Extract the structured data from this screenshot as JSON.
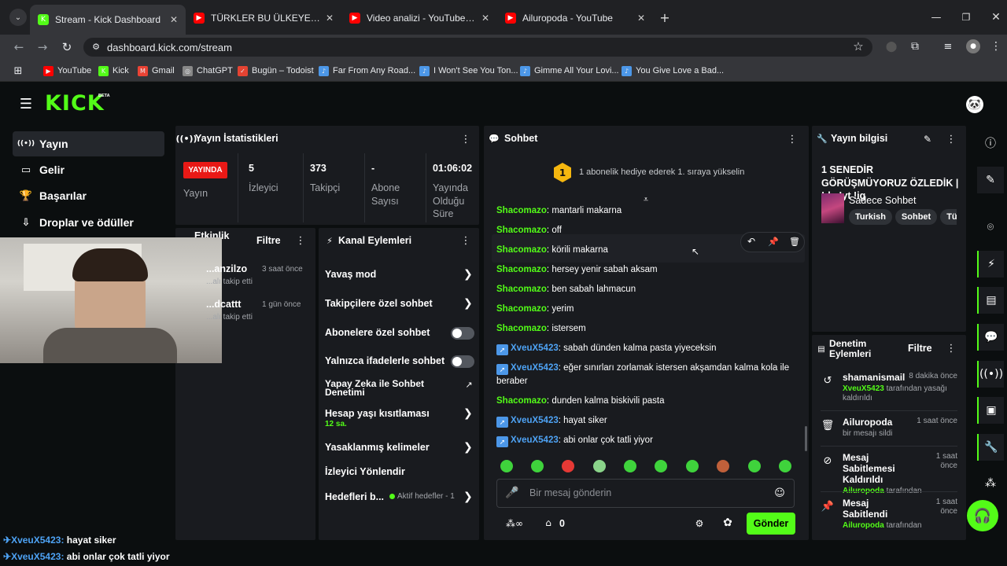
{
  "browser": {
    "tabs": [
      {
        "title": "Stream - Kick Dashboard",
        "active": true,
        "fav": "K",
        "favbg": "#53fc18"
      },
      {
        "title": "TÜRKLER BU ÜLKEYE MUTLAKA",
        "active": false,
        "fav": "▶",
        "favbg": "#ff0000"
      },
      {
        "title": "Video analizi - YouTube Studio",
        "active": false,
        "fav": "▶",
        "favbg": "#ff0000"
      },
      {
        "title": "Ailuropoda - YouTube",
        "active": false,
        "fav": "▶",
        "favbg": "#ff0000"
      }
    ],
    "url": "dashboard.kick.com/stream",
    "bookmarks": [
      "YouTube",
      "Kick",
      "Gmail",
      "ChatGPT",
      "Bugün – Todoist",
      "Far From Any Road...",
      "I Won't See You Ton...",
      "Gimme All Your Lovi...",
      "You Give Love a Bad..."
    ]
  },
  "brand": {
    "logo": "KICK",
    "beta": "BETA"
  },
  "sidebar": {
    "items": [
      {
        "label": "Yayın",
        "icon": "broadcast-icon"
      },
      {
        "label": "Gelir",
        "icon": "money-icon"
      },
      {
        "label": "Başarılar",
        "icon": "trophy-icon"
      },
      {
        "label": "Droplar ve ödüller",
        "icon": "gift-icon"
      }
    ]
  },
  "stats": {
    "title": "Yayın İstatistikleri",
    "live_badge": "YAYINDA",
    "live_label": "Yayın",
    "items": [
      {
        "value": "5",
        "label": "İzleyici"
      },
      {
        "value": "373",
        "label": "Takipçi"
      },
      {
        "value": "-",
        "label": "Abone Sayısı"
      },
      {
        "value": "01:06:02",
        "label": "Yayında Olduğu Süre"
      }
    ]
  },
  "activity": {
    "title": "Etkinlik",
    "filter": "Filtre",
    "items": [
      {
        "name": "...anzilzo",
        "time": "3 saat önce",
        "desc": "...alı takip etti"
      },
      {
        "name": "...dcattt",
        "time": "1 gün önce",
        "desc": "...alı takip etti"
      }
    ]
  },
  "channel_actions": {
    "title": "Kanal Eylemleri",
    "rows": [
      {
        "label": "Yavaş mod"
      },
      {
        "label": "Takipçilere özel sohbet"
      },
      {
        "label": "Abonelere özel sohbet"
      },
      {
        "label": "Yalnızca ifadelerle sohbet"
      },
      {
        "label": "Yapay Zeka ile Sohbet Denetimi"
      },
      {
        "label": "Hesap yaşı kısıtlaması",
        "sub": "12 sa."
      },
      {
        "label": "Yasaklanmış kelimeler"
      },
      {
        "label": "İzleyici Yönlendir"
      },
      {
        "label": "Hedefleri b...",
        "status": "Aktif hedefler - 1"
      }
    ]
  },
  "chat": {
    "title": "Sohbet",
    "gift_rank": "1",
    "gift_text": "1 abonelik hediye ederek 1. sıraya yükselin",
    "messages": [
      {
        "user": "Shacomazo",
        "text": "mantarli makarna",
        "badge": false
      },
      {
        "user": "Shacomazo",
        "text": "off",
        "badge": false
      },
      {
        "user": "Shacomazo",
        "text": "körili makarna",
        "badge": false
      },
      {
        "user": "Shacomazo",
        "text": "hersey yenir sabah aksam",
        "badge": false
      },
      {
        "user": "Shacomazo",
        "text": "ben sabah lahmacun",
        "badge": false
      },
      {
        "user": "Shacomazo",
        "text": "yerim",
        "badge": false
      },
      {
        "user": "Shacomazo",
        "text": "istersem",
        "badge": false
      },
      {
        "user": "XveuX5423",
        "text": "sabah dünden kalma pasta yiyeceksin",
        "badge": true
      },
      {
        "user": "XveuX5423",
        "text": "eğer sınırları zorlamak istersen akşamdan kalma kola ile beraber",
        "badge": true
      },
      {
        "user": "Shacomazo",
        "text": "dunden kalma biskivili pasta",
        "badge": false
      },
      {
        "user": "XveuX5423",
        "text": "hayat siker",
        "badge": true
      },
      {
        "user": "XveuX5423",
        "text": "abi onlar çok tatli yiyor",
        "badge": true
      }
    ],
    "input_placeholder": "Bir mesaj gönderin",
    "points": "0",
    "send_label": "Gönder"
  },
  "stream_info": {
    "title": "Yayın bilgisi",
    "stream_title": "1 SENEDİR GÖRÜŞMÜYORUZ ÖZLEDİK | !dc !yt !ig",
    "category": "Sadece Sohbet",
    "tags": [
      "Turkish",
      "Sohbet",
      "Türk"
    ]
  },
  "moderation": {
    "title": "Denetim Eylemleri",
    "filter": "Filtre",
    "items": [
      {
        "user": "shamanismail",
        "time": "8 dakika önce",
        "actor": "XveuX5423",
        "desc": "tarafından yasağı kaldırıldı",
        "icon": "undo-icon"
      },
      {
        "user": "Ailuropoda",
        "time": "1 saat önce",
        "actor": "",
        "desc": "bir mesajı sildi",
        "icon": "trash-icon"
      },
      {
        "user": "Mesaj Sabitlemesi Kaldırıldı",
        "time": "1 saat önce",
        "actor": "Ailuropoda",
        "desc": "tarafından",
        "icon": "unpin-icon"
      },
      {
        "user": "Mesaj Sabitlendi",
        "time": "1 saat önce",
        "actor": "Ailuropoda",
        "desc": "tarafından",
        "icon": "pin-icon"
      }
    ]
  },
  "overlay_chat": [
    {
      "user": "XveuX5423:",
      "text": "hayat siker"
    },
    {
      "user": "XveuX5423:",
      "text": "abi onlar çok tatli yiyor"
    }
  ],
  "colors": {
    "kick_green": "#53fc18",
    "live_red": "#e91916",
    "badge_blue": "#4c97e8"
  }
}
